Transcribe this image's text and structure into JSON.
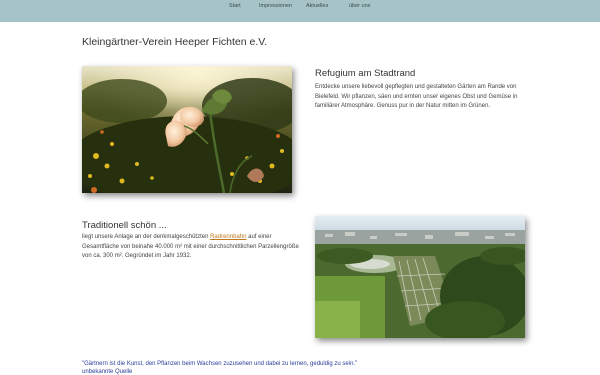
{
  "nav": {
    "items": [
      {
        "label": "Start"
      },
      {
        "label": "Impressionen"
      },
      {
        "label": "Aktuelles"
      },
      {
        "label": "über uns"
      }
    ]
  },
  "site": {
    "title": "Kleingärtner-Verein Heeper Fichten e.V."
  },
  "section1": {
    "heading": "Refugium am Stadtrand",
    "text": "Entdecke unsere liebevoll gepflegten und gestalteten Gärten am Rande von Bielefeld. Wir pflanzen, säen und ernten unser eigenes Obst und Gemüse in familiärer Atmosphäre. Genuss pur in der Natur mitten im Grünen."
  },
  "section2": {
    "heading": "Traditionell schön ...",
    "text_before": "liegt unsere Anlage an der denkmalgeschützten ",
    "link": "Radrennbahn",
    "text_after": " auf einer Gesamtfläche von beinahe 40.000 m² mit einer durchschnittlichen Parzellengröße von ca. 300 m². Gegründet im Jahr 1932."
  },
  "quote": {
    "text": "\"Gärtnern ist die Kunst, den Pflanzen beim Wachsen zuzusehen und dabei zu lernen, geduldig zu sein.\"",
    "source": "unbekannte Quelle"
  },
  "colors": {
    "nav_bg": "#a6c4c8",
    "link": "#c07a1e",
    "quote": "#2a3c9a"
  }
}
